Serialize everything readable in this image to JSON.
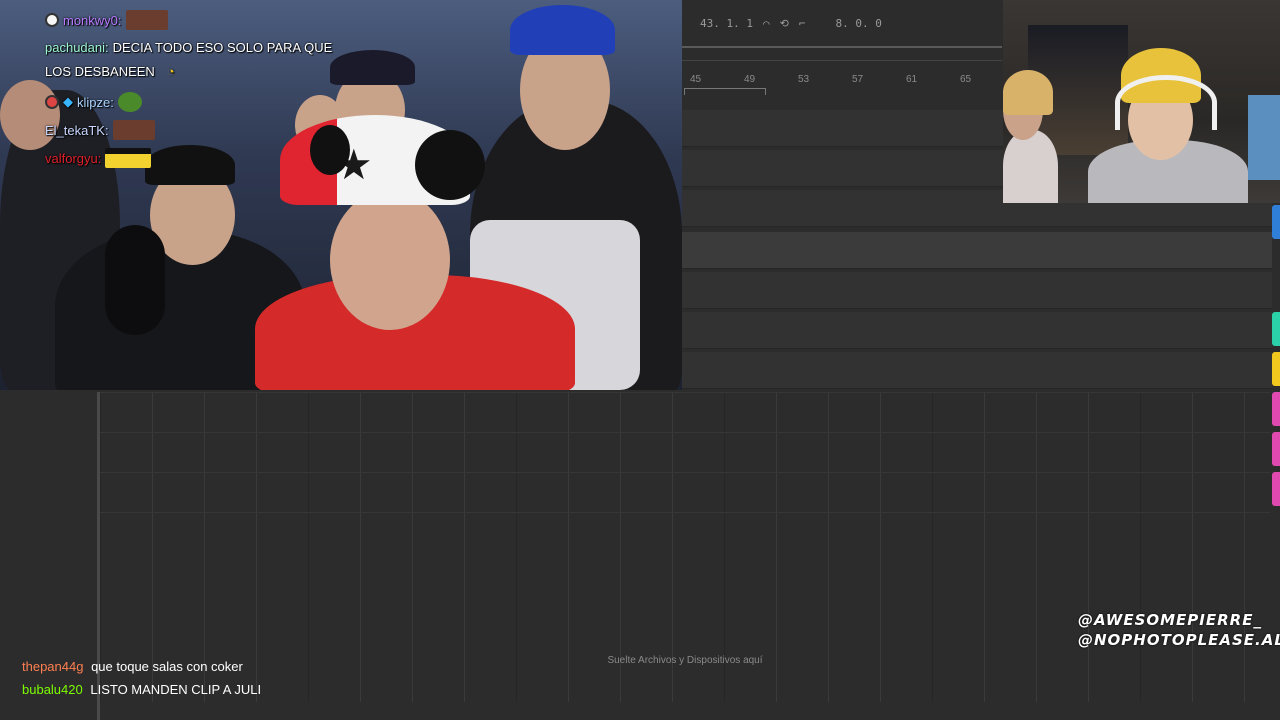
{
  "transport": {
    "position": "43. 1. 1",
    "loop_end": "8. 0. 0"
  },
  "ruler": {
    "bars": [
      "45",
      "49",
      "53",
      "57",
      "61",
      "65"
    ]
  },
  "chat_top": [
    {
      "user": "monkwy0:",
      "user_color": "#b77bff",
      "message": "",
      "has_badge": true,
      "emote": "face-emote"
    },
    {
      "user": "pachudani:",
      "user_color": "#9cf5d0",
      "message": "DECIA TODO ESO SOLO PARA QUE",
      "has_badge": false,
      "emote": ""
    },
    {
      "user": "",
      "user_color": "#ffffff",
      "message": "LOS DESBANEEN",
      "has_badge": false,
      "emote": "small-emote"
    },
    {
      "user": "klipze:",
      "user_color": "#a9d3ff",
      "message": "",
      "has_badge": true,
      "emote": "pepe-emote"
    },
    {
      "user": "El_tekaTK:",
      "user_color": "#c8d7ff",
      "message": "",
      "has_badge": false,
      "emote": "face-emote"
    },
    {
      "user": "valforgyu:",
      "user_color": "#e0202a",
      "message": "",
      "has_badge": false,
      "emote": "minion-emote"
    }
  ],
  "chat_bottom": [
    {
      "user": "thepan44g",
      "user_color": "#ff7f50",
      "message": "que toque salas con coker"
    },
    {
      "user": "bubalu420",
      "user_color": "#7CFC00",
      "message": "LISTO MANDEN CLIP A JULI"
    }
  ],
  "drop_hint": "Suelte Archivos y Dispositivos aquí",
  "credits": {
    "line1": "@AWESOMEPIERRE_",
    "line2": "@NOPHOTOPLEASE.ALS"
  },
  "side_tab_colors": [
    "#2f7fd8",
    "#2bd1a8",
    "#f2c81e",
    "#e04ab0",
    "#e04ab0",
    "#e04ab0"
  ]
}
